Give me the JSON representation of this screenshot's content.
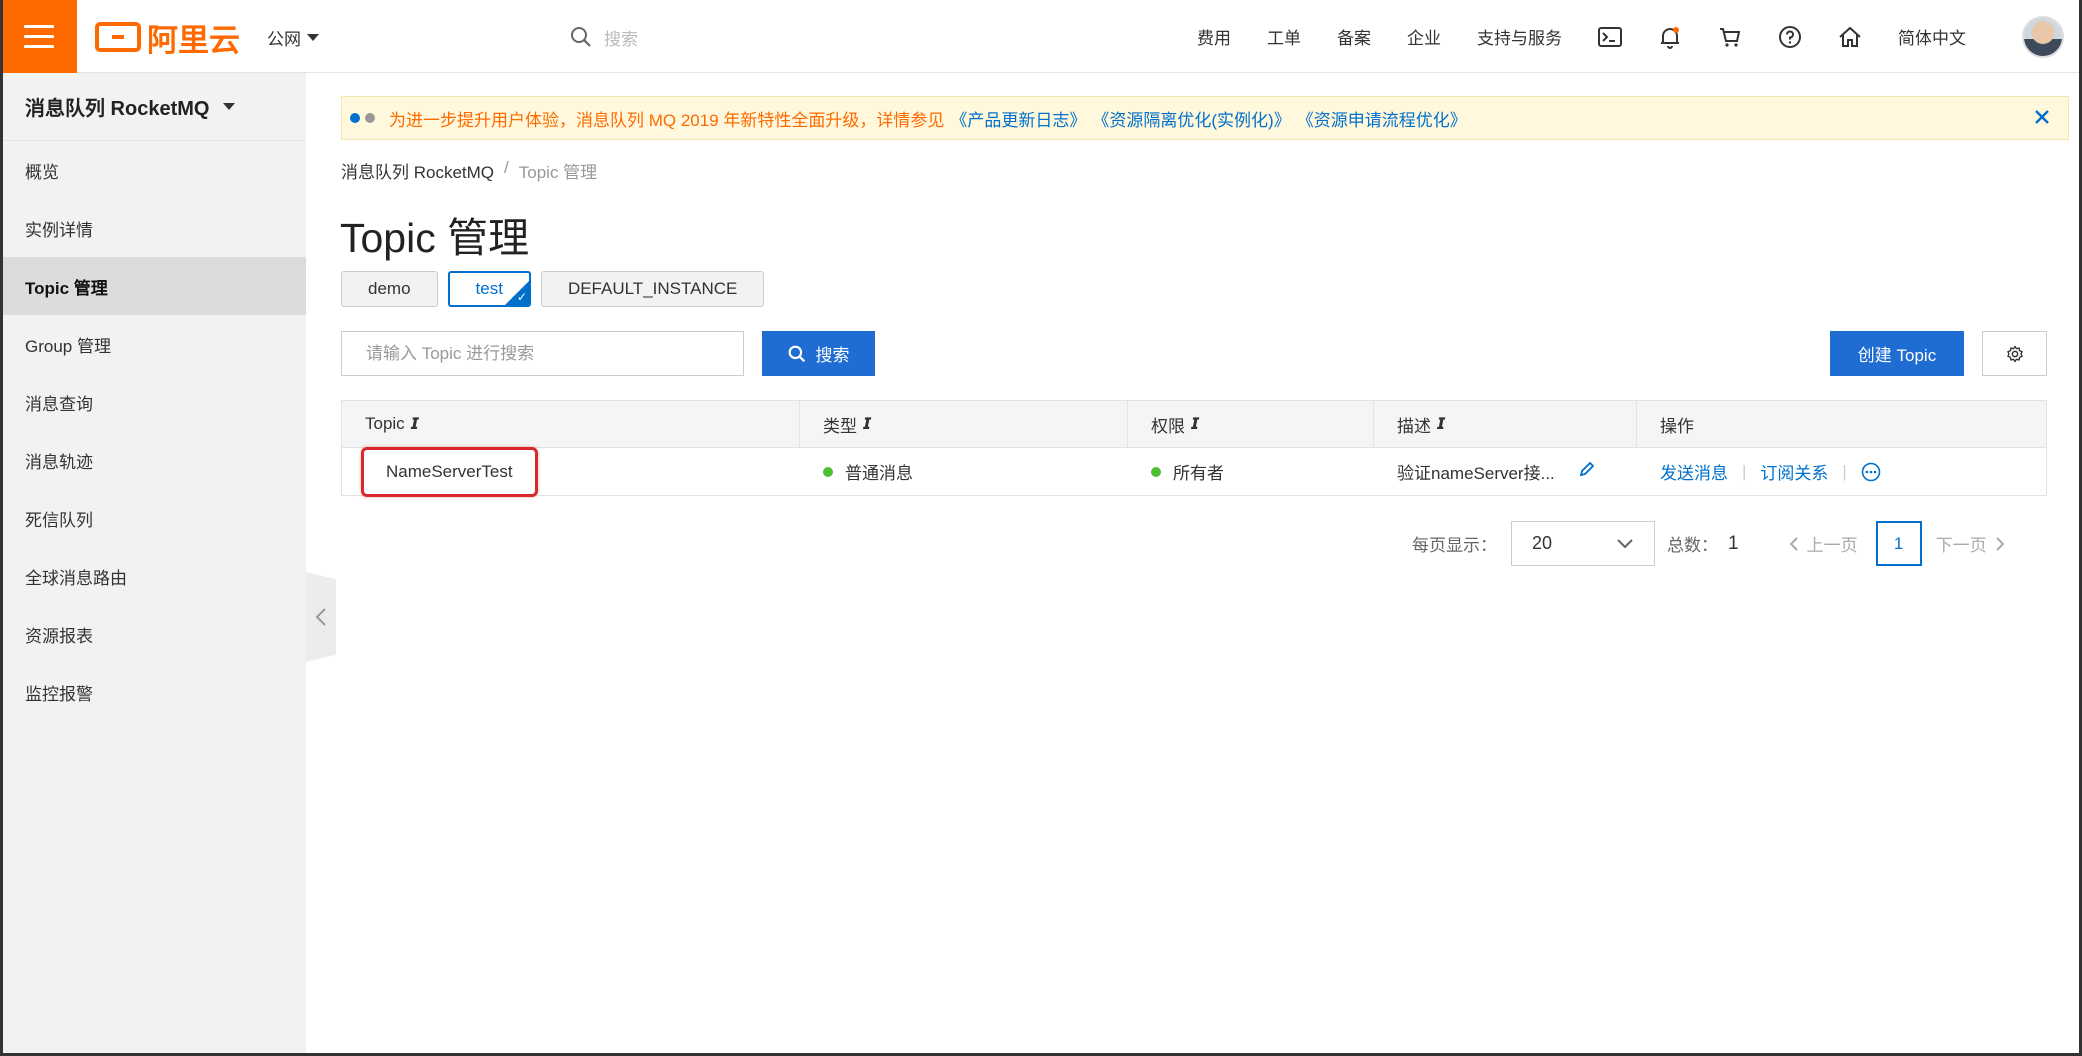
{
  "topbar": {
    "logo_text": "阿里云",
    "region": "公网",
    "search_placeholder": "搜索",
    "nav": [
      "费用",
      "工单",
      "备案",
      "企业",
      "支持与服务"
    ],
    "language": "简体中文"
  },
  "sidebar": {
    "product": "消息队列 RocketMQ",
    "items": [
      {
        "label": "概览"
      },
      {
        "label": "实例详情"
      },
      {
        "label": "Topic 管理"
      },
      {
        "label": "Group 管理"
      },
      {
        "label": "消息查询"
      },
      {
        "label": "消息轨迹"
      },
      {
        "label": "死信队列"
      },
      {
        "label": "全球消息路由"
      },
      {
        "label": "资源报表"
      },
      {
        "label": "监控报警"
      }
    ],
    "active_index": 2
  },
  "notice": {
    "text": "为进一步提升用户体验，消息队列 MQ 2019 年新特性全面升级，详情参见",
    "links": [
      "《产品更新日志》",
      "《资源隔离优化(实例化)》",
      "《资源申请流程优化》"
    ]
  },
  "breadcrumb": {
    "parent": "消息队列 RocketMQ",
    "separator": "/",
    "current": "Topic 管理"
  },
  "page_title": "Topic 管理",
  "instance_tabs": [
    "demo",
    "test",
    "DEFAULT_INSTANCE"
  ],
  "toolbar": {
    "search_placeholder": "请输入 Topic 进行搜索",
    "search_label": "搜索",
    "create_label": "创建 Topic"
  },
  "table": {
    "headers": [
      "Topic",
      "类型",
      "权限",
      "描述",
      "操作"
    ],
    "rows": [
      {
        "topic": "NameServerTest",
        "type": "普通消息",
        "permission": "所有者",
        "description": "验证nameServer接...",
        "actions": [
          "发送消息",
          "订阅关系"
        ]
      }
    ]
  },
  "pagination": {
    "page_size_label": "每页显示：",
    "page_size": "20",
    "total_label": "总数：",
    "total": "1",
    "prev": "上一页",
    "current_page": "1",
    "next": "下一页"
  },
  "colors": {
    "brand_orange": "#ff6a00",
    "primary_blue": "#1f6dd2",
    "link_blue": "#0070cc",
    "status_green": "#4cc133",
    "highlight_red": "#d9272e"
  }
}
